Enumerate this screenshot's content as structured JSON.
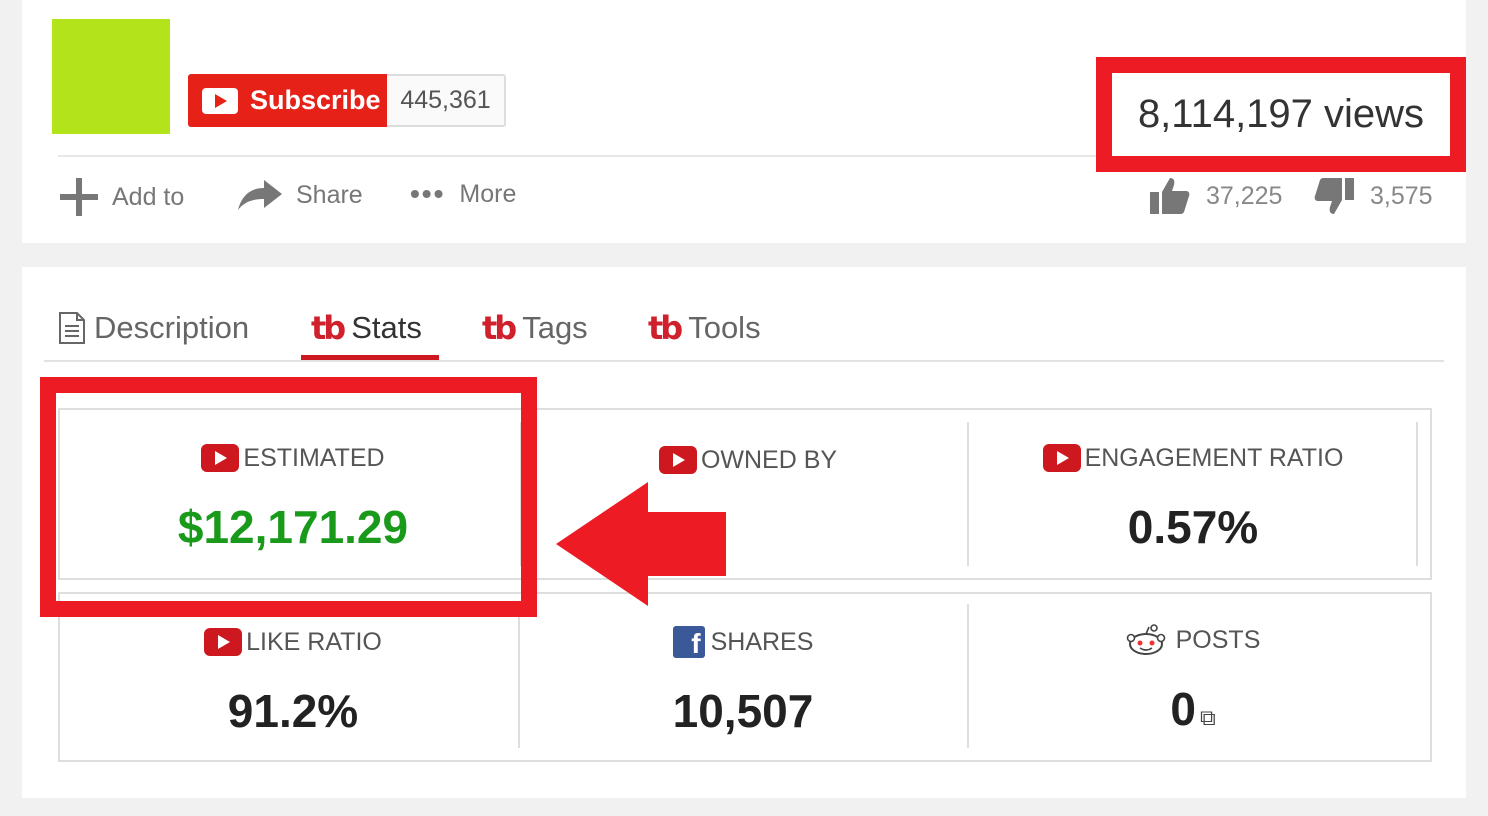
{
  "channel": {
    "subscribe_label": "Subscribe",
    "subscriber_count": "445,361",
    "avatar_color": "#b3e31a"
  },
  "video": {
    "views": "8,114,197 views",
    "likes": "37,225",
    "dislikes": "3,575"
  },
  "actions": {
    "add_to": "Add to",
    "share": "Share",
    "more": "More"
  },
  "tabs": [
    {
      "label": "Description",
      "active": false
    },
    {
      "label": "Stats",
      "active": true
    },
    {
      "label": "Tags",
      "active": false
    },
    {
      "label": "Tools",
      "active": false
    }
  ],
  "tab_brand_glyph": "tb",
  "stats": {
    "estimated": {
      "label": "ESTIMATED",
      "value": "$12,171.29"
    },
    "owned_by": {
      "label": "OWNED BY",
      "value": ""
    },
    "engagement": {
      "label": "ENGAGEMENT RATIO",
      "value": "0.57%"
    },
    "like_ratio": {
      "label": "LIKE RATIO",
      "value": "91.2%"
    },
    "shares": {
      "label": "SHARES",
      "value": "10,507"
    },
    "posts": {
      "label": "POSTS",
      "value": "0"
    }
  },
  "colors": {
    "youtube_red": "#e62117",
    "highlight_red": "#ed1c24",
    "estimated_green": "#1a9a1a",
    "facebook_blue": "#3b5998"
  },
  "icons": [
    "plus-icon",
    "share-arrow-icon",
    "more-dots-icon",
    "thumbs-up-icon",
    "thumbs-down-icon",
    "document-icon",
    "youtube-icon",
    "facebook-icon",
    "reddit-icon",
    "external-link-icon"
  ]
}
